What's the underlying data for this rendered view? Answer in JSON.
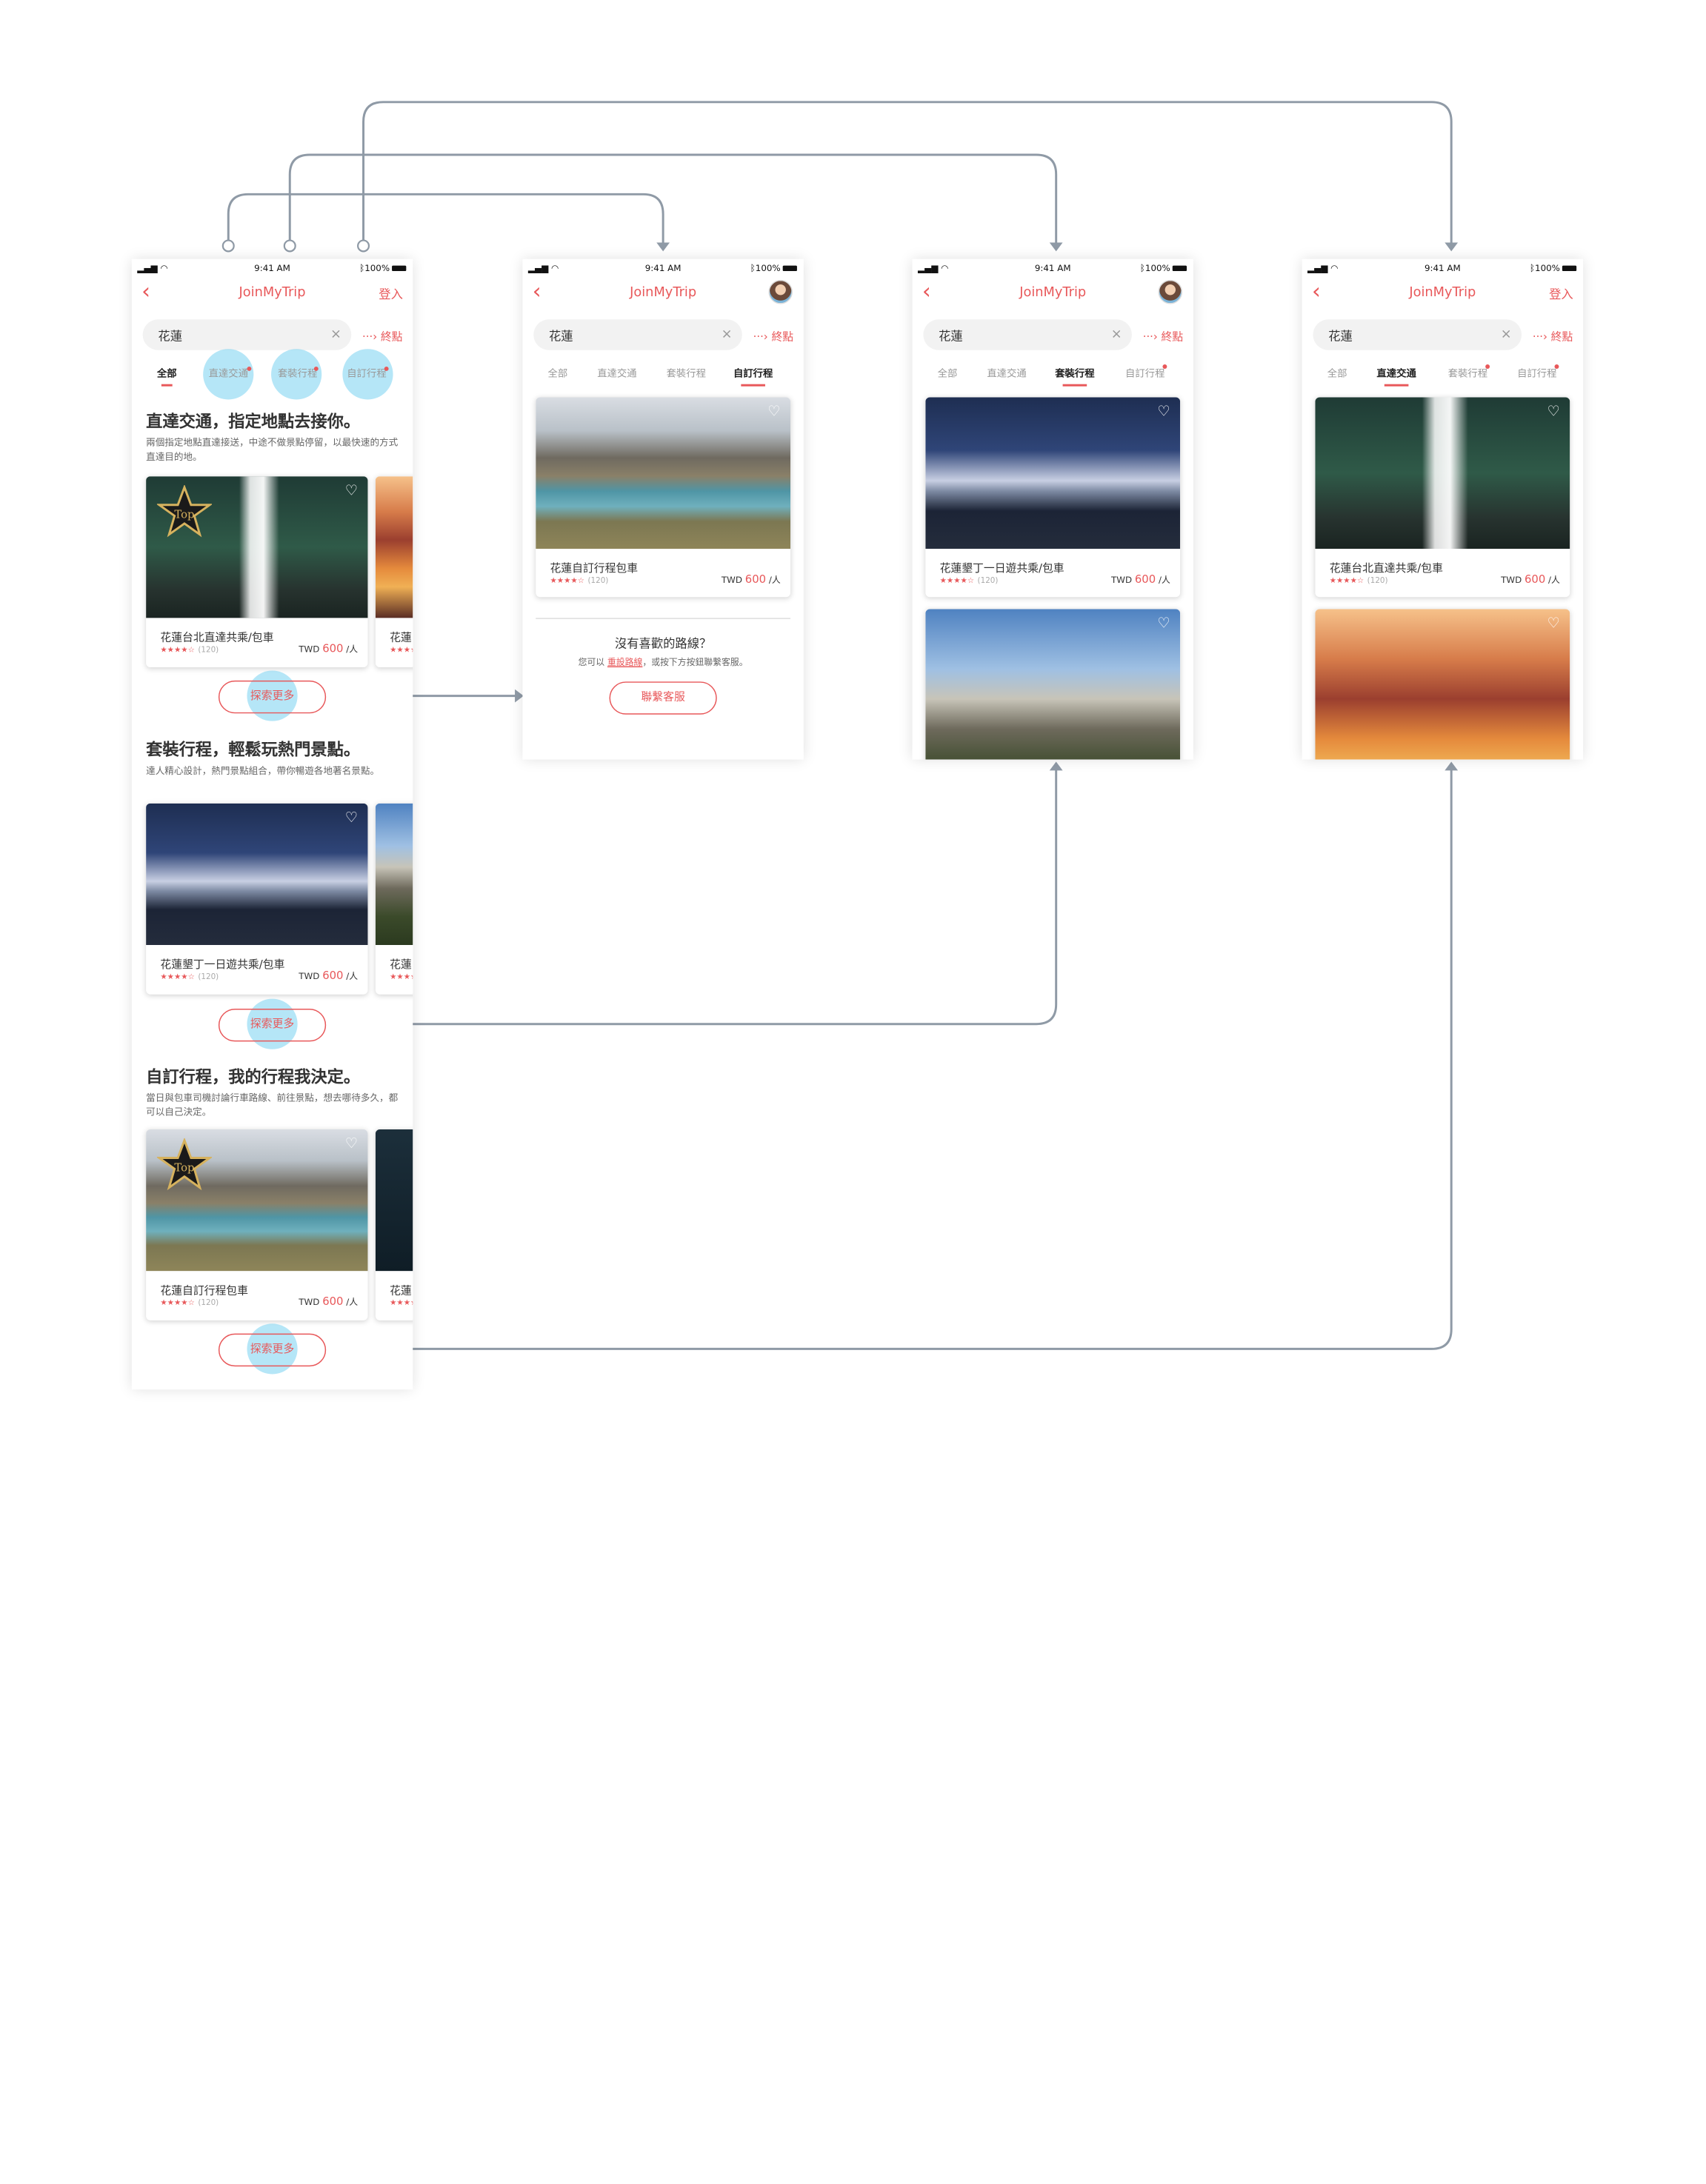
{
  "status": {
    "time": "9:41 AM",
    "battery": "100%"
  },
  "app": {
    "title": "JoinMyTrip",
    "login": "登入"
  },
  "search": {
    "value": "花蓮",
    "clear": "×",
    "dest_arrow": "···›",
    "dest_label": "終點"
  },
  "tabs": [
    "全部",
    "直達交通",
    "套裝行程",
    "自訂行程"
  ],
  "sections": [
    {
      "title": "直達交通，指定地點去接你。",
      "desc": "兩個指定地點直達接送，中途不做景點停留，以最快速的方式直達目的地。"
    },
    {
      "title": "套裝行程，輕鬆玩熱門景點。",
      "desc": "達人精心設計，熱門景點組合，帶你暢遊各地著名景點。"
    },
    {
      "title": "自訂行程，我的行程我決定。",
      "desc": "當日與包車司機討論行車路線、前往景點，想去哪待多久，都可以自己決定。"
    }
  ],
  "cards": {
    "direct": "花蓮台北直達共乘/包車",
    "package": "花蓮墾丁一日遊共乘/包車",
    "custom": "花蓮自訂行程包車",
    "peek": "花蓮",
    "stars": "★★★★☆",
    "reviews": "(120)",
    "currency": "TWD",
    "price": "600",
    "unit": "/人"
  },
  "more_button": "探索更多",
  "empty": {
    "title": "沒有喜歡的路線？",
    "desc_prefix": "您可以",
    "link": "重設路線",
    "desc_suffix": "，或按下方按鈕聯繫客服。",
    "button": "聯繫客服"
  },
  "colors": {
    "accent": "#e8585a",
    "connector": "#8f9aa6",
    "highlight": "#78d2f0"
  },
  "icons": [
    "back-chevron-icon",
    "clear-icon",
    "arrow-right-icon",
    "heart-icon",
    "star-icon",
    "avatar-icon",
    "signal-icon",
    "wifi-icon",
    "battery-icon",
    "bluetooth-icon",
    "top-badge-icon"
  ]
}
